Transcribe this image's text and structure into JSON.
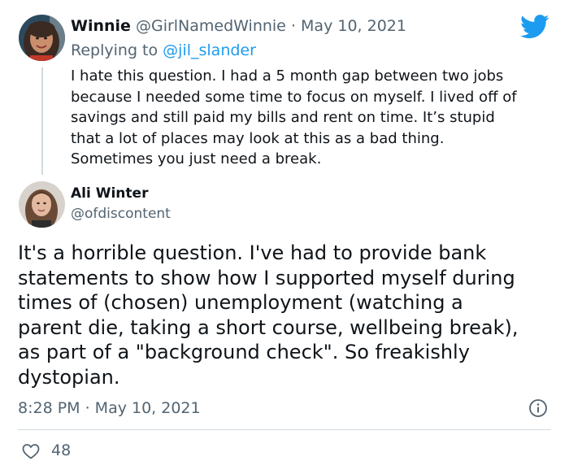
{
  "reply": {
    "display_name": "Winnie",
    "handle": "@GirlNamedWinnie",
    "separator": "·",
    "date": "May 10, 2021",
    "replying_prefix": "Replying to",
    "replying_to": "@jil_slander",
    "body_lines": [
      "I hate this question. I had a 5 month gap between two jobs",
      "because I needed some time to focus on myself. I lived off of",
      "savings and still paid my bills and rent on time. It’s stupid",
      "that a lot of places may look at this as a bad thing.",
      "Sometimes you just need a break."
    ]
  },
  "main": {
    "display_name": "Ali Winter",
    "handle": "@ofdiscontent",
    "body_lines": [
      "It's a horrible question. I've had to provide bank",
      "statements to show how I supported myself during",
      "times of (chosen) unemployment (watching a",
      "parent die, taking a short course, wellbeing break),",
      "as part of a \"background check\". So freakishly",
      "dystopian."
    ],
    "timestamp": "8:28 PM · May 10, 2021",
    "likes": "48"
  },
  "icons": {
    "brand": "twitter-bird-icon",
    "info": "info-icon",
    "like": "heart-icon"
  },
  "colors": {
    "brand_blue": "#1d9bf0",
    "muted_text": "#536471",
    "divider": "#cfd9de"
  }
}
